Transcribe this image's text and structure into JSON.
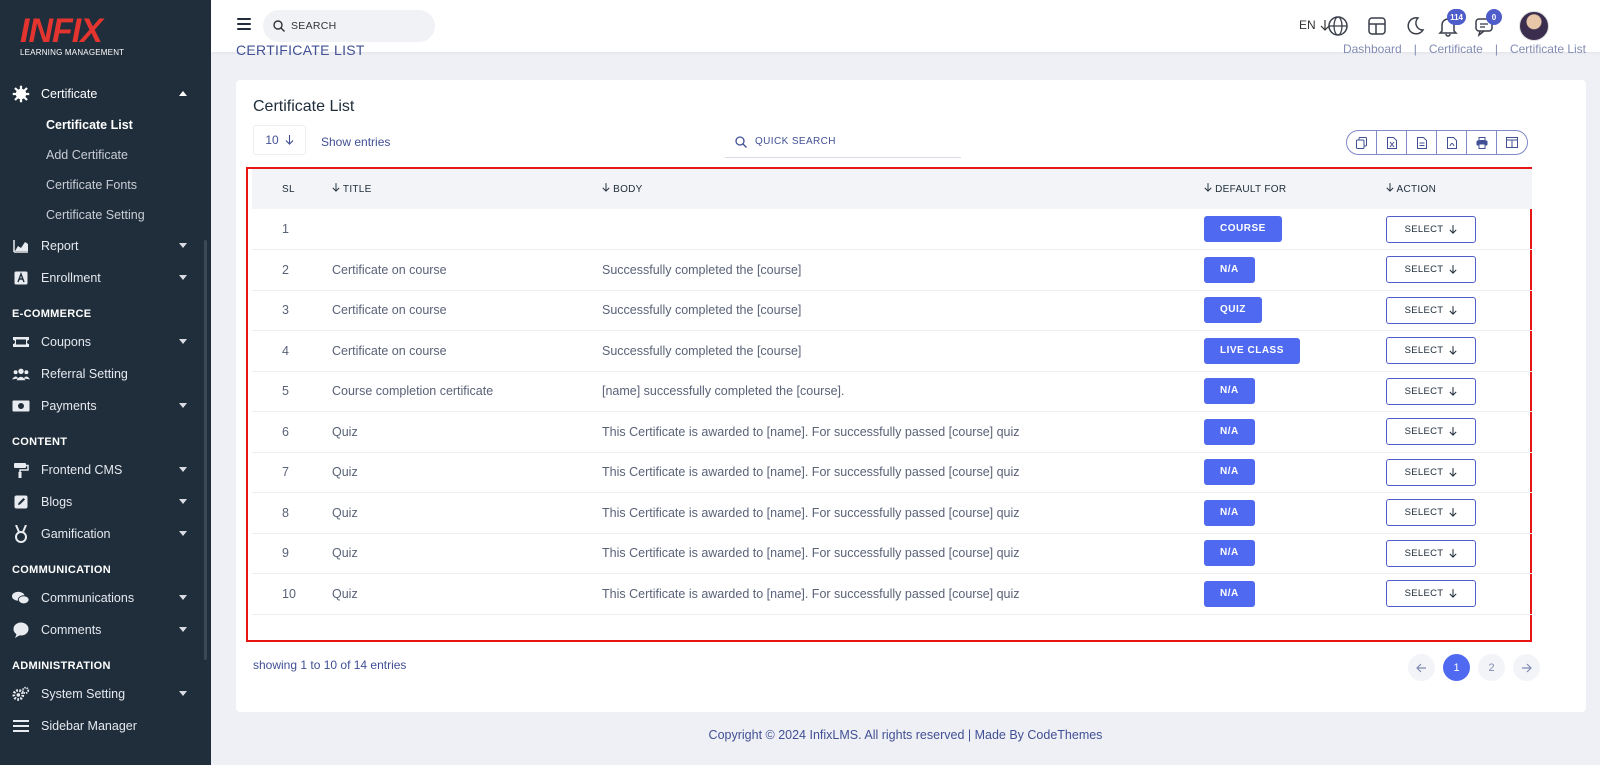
{
  "brand": {
    "name": "INFIX",
    "tagline": "LEARNING MANAGEMENT"
  },
  "sidebar": {
    "items": [
      {
        "label": "Certificate",
        "icon": "gear-icon",
        "expanded": true
      },
      {
        "label": "Certificate List",
        "sub": true,
        "active": true
      },
      {
        "label": "Add Certificate",
        "sub": true
      },
      {
        "label": "Certificate Fonts",
        "sub": true
      },
      {
        "label": "Certificate Setting",
        "sub": true
      },
      {
        "label": "Report",
        "icon": "chart-icon"
      },
      {
        "label": "Enrollment",
        "icon": "enroll-icon"
      }
    ],
    "sections": {
      "ecommerce": "E-COMMERCE",
      "content": "CONTENT",
      "communication": "COMMUNICATION",
      "administration": "ADMINISTRATION"
    },
    "ecommerce_items": [
      "Coupons",
      "Referral Setting",
      "Payments"
    ],
    "content_items": [
      "Frontend CMS",
      "Blogs",
      "Gamification"
    ],
    "communication_items": [
      "Communications",
      "Comments"
    ],
    "administration_items": [
      "System Setting",
      "Sidebar Manager"
    ]
  },
  "header": {
    "search_placeholder": "SEARCH",
    "language": "EN",
    "notification_count": "114",
    "message_count": "0"
  },
  "page": {
    "heading": "CERTIFICATE LIST",
    "breadcrumb": [
      "Dashboard",
      "|",
      "Certificate",
      "|",
      "Certificate List"
    ]
  },
  "card": {
    "title": "Certificate List",
    "entries_value": "10",
    "show_entries": "Show entries",
    "quick_search_placeholder": "QUICK SEARCH",
    "export_buttons": [
      "copy-icon",
      "excel-icon",
      "csv-icon",
      "pdf-icon",
      "print-icon",
      "columns-icon"
    ]
  },
  "table": {
    "headers": {
      "sl": "SL",
      "title": "TITLE",
      "body": "BODY",
      "default_for": "DEFAULT FOR",
      "action": "ACTION"
    },
    "action_label": "SELECT",
    "rows": [
      {
        "sl": "1",
        "title": "",
        "body": "",
        "default_for": "COURSE"
      },
      {
        "sl": "2",
        "title": "Certificate on course",
        "body": "Successfully completed the [course]",
        "default_for": "N/A"
      },
      {
        "sl": "3",
        "title": "Certificate on course",
        "body": "Successfully completed the [course]",
        "default_for": "QUIZ"
      },
      {
        "sl": "4",
        "title": "Certificate on course",
        "body": "Successfully completed the [course]",
        "default_for": "LIVE CLASS"
      },
      {
        "sl": "5",
        "title": "Course completion certificate",
        "body": "[name] successfully completed the [course].",
        "default_for": "N/A"
      },
      {
        "sl": "6",
        "title": "Quiz",
        "body": "This Certificate is awarded to [name]. For successfully passed [course] quiz",
        "default_for": "N/A"
      },
      {
        "sl": "7",
        "title": "Quiz",
        "body": "This Certificate is awarded to [name]. For successfully passed [course] quiz",
        "default_for": "N/A"
      },
      {
        "sl": "8",
        "title": "Quiz",
        "body": "This Certificate is awarded to [name]. For successfully passed [course] quiz",
        "default_for": "N/A"
      },
      {
        "sl": "9",
        "title": "Quiz",
        "body": "This Certificate is awarded to [name]. For successfully passed [course] quiz",
        "default_for": "N/A"
      },
      {
        "sl": "10",
        "title": "Quiz",
        "body": "This Certificate is awarded to [name]. For successfully passed [course] quiz",
        "default_for": "N/A"
      }
    ]
  },
  "pagination": {
    "summary": "showing 1 to 10 of 14 entries",
    "pages": [
      "1",
      "2"
    ],
    "current": "1"
  },
  "footer": {
    "text": "Copyright © 2024 InfixLMS. All rights reserved | Made By CodeThemes"
  },
  "colors": {
    "sidebar_bg": "#202e3b",
    "accent": "#4f6af0",
    "brand_red": "#e3342f",
    "highlight_frame": "#e81515"
  }
}
